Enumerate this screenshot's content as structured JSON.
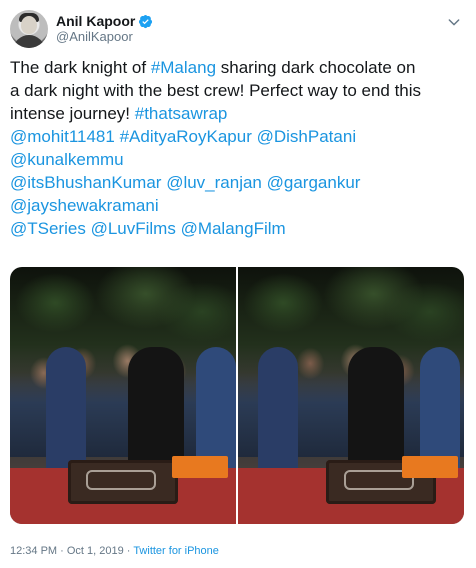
{
  "author": {
    "display_name": "Anil Kapoor",
    "handle": "@AnilKapoor",
    "verified": true
  },
  "tweet": {
    "lines": [
      [
        {
          "text": "The dark knight of ",
          "link": false
        },
        {
          "text": "#Malang",
          "link": true
        },
        {
          "text": " sharing dark chocolate on",
          "link": false
        }
      ],
      [
        {
          "text": "a dark night with the best crew! Perfect way to end this",
          "link": false
        }
      ],
      [
        {
          "text": "intense journey! ",
          "link": false
        },
        {
          "text": "#thatsawrap",
          "link": true
        }
      ],
      [
        {
          "text": "@mohit11481",
          "link": true
        },
        {
          "text": " ",
          "link": false
        },
        {
          "text": "#AdityaRoyKapur",
          "link": true
        },
        {
          "text": " ",
          "link": false
        },
        {
          "text": "@DishPatani",
          "link": true
        }
      ],
      [
        {
          "text": " ",
          "link": false
        },
        {
          "text": "@kunalkemmu",
          "link": true
        }
      ],
      [
        {
          "text": "@itsBhushanKumar",
          "link": true
        },
        {
          "text": " ",
          "link": false
        },
        {
          "text": "@luv_ranjan",
          "link": true
        },
        {
          "text": " ",
          "link": false
        },
        {
          "text": "@gargankur",
          "link": true
        }
      ],
      [
        {
          "text": " ",
          "link": false
        },
        {
          "text": "@jayshewakramani",
          "link": true
        }
      ],
      [
        {
          "text": "@TSeries",
          "link": true
        },
        {
          "text": " ",
          "link": false
        },
        {
          "text": "@LuvFilms",
          "link": true
        },
        {
          "text": " ",
          "link": false
        },
        {
          "text": "@MalangFilm",
          "link": true
        }
      ]
    ]
  },
  "meta": {
    "timestamp": "12:34 PM · Oct 1, 2019",
    "separator": " · ",
    "source": "Twitter for iPhone"
  },
  "icons": {
    "verified": "verified-badge-icon",
    "menu": "chevron-down-icon"
  },
  "colors": {
    "link": "#1b95e0",
    "text": "#14171a",
    "secondary": "#657786"
  }
}
